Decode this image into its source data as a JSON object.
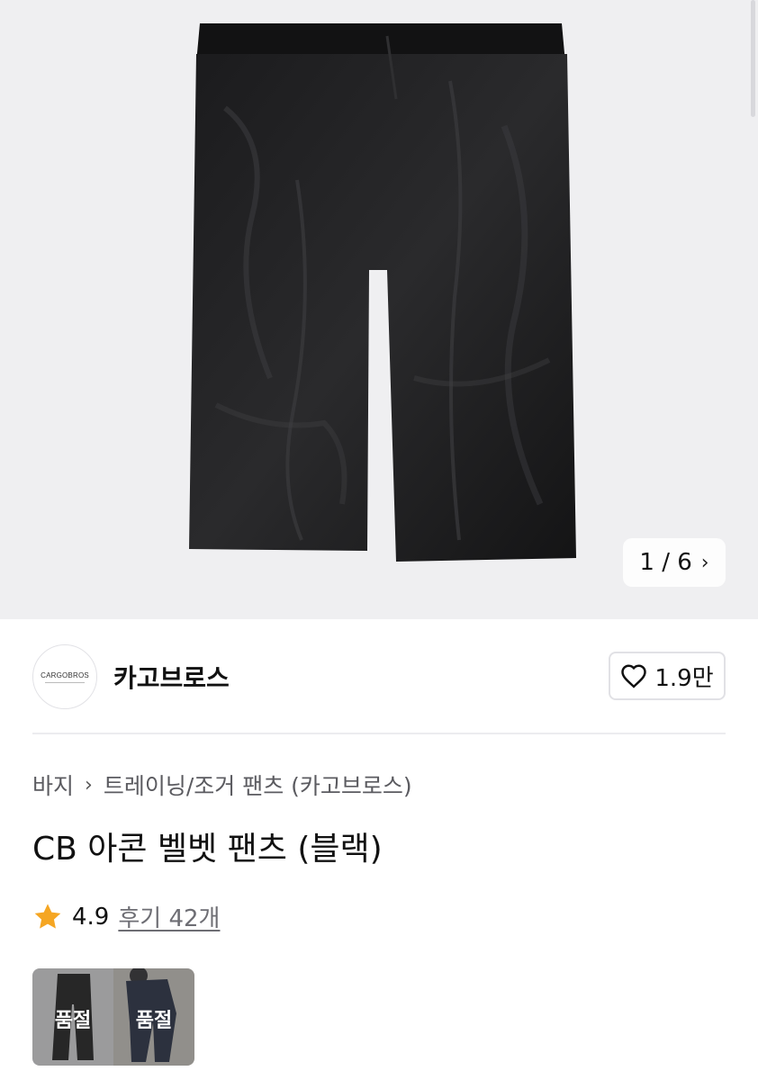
{
  "gallery": {
    "pager_current": "1",
    "pager_total": "6",
    "pager_text": "1 / 6",
    "image_subject": "black velvet wide pants"
  },
  "brand": {
    "logo_text": "CARGOBROS",
    "name": "카고브로스",
    "like_count": "1.9만"
  },
  "breadcrumb": {
    "items": [
      "바지",
      "트레이닝/조거 팬츠 (카고브로스)"
    ]
  },
  "product": {
    "title": "CB 아콘 벨벳 팬츠 (블랙)",
    "rating": "4.9",
    "reviews": "후기 42개"
  },
  "swatches": [
    {
      "label": "품절",
      "color": "black"
    },
    {
      "label": "품절",
      "color": "navy"
    }
  ],
  "colors": {
    "star": "#f5a623",
    "hero_bg": "#efeff1"
  }
}
